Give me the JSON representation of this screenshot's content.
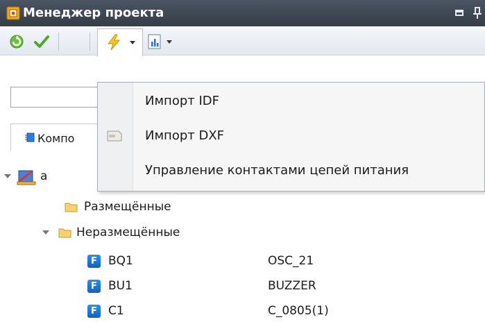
{
  "titlebar": {
    "title": "Менеджер проекта",
    "icons": [
      "app-icon",
      "restore-icon",
      "pin-icon"
    ]
  },
  "toolbar": {
    "buttons": [
      "refresh-icon",
      "check-icon",
      "lightning-icon",
      "report-icon"
    ]
  },
  "search": {
    "value": ""
  },
  "tabs": [
    {
      "label": "Компо",
      "icon": "component-icon"
    }
  ],
  "menu": {
    "items": [
      {
        "label": "Импорт IDF",
        "icon": ""
      },
      {
        "label": "Импорт DXF",
        "icon": "dxf-file-icon"
      },
      {
        "label": "Управление контактами цепей питания",
        "icon": ""
      }
    ]
  },
  "tree": {
    "root": {
      "label": "a",
      "icon": "board-icon"
    },
    "folders": [
      {
        "label": "Размещённые"
      },
      {
        "label": "Неразмещённые"
      }
    ],
    "components": [
      {
        "name": "BQ1",
        "value": "OSC_21"
      },
      {
        "name": "BU1",
        "value": "BUZZER"
      },
      {
        "name": "C1",
        "value": "C_0805(1)"
      }
    ]
  },
  "colors": {
    "titlebar": "#3e4652",
    "component_icon": "#1f74d6",
    "folder": "#f2c94c"
  }
}
